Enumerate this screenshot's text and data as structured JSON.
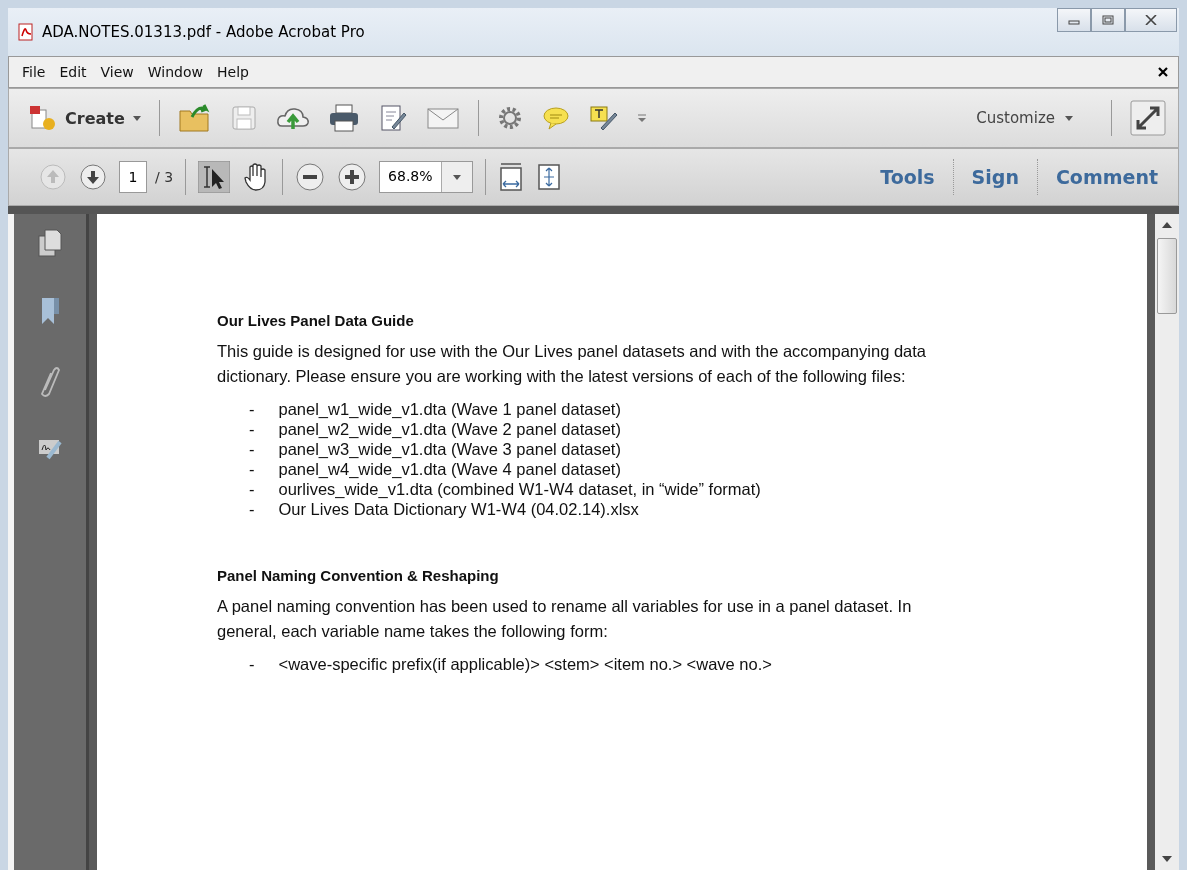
{
  "window": {
    "title": "ADA.NOTES.01313.pdf - Adobe Acrobat Pro"
  },
  "menu": [
    "File",
    "Edit",
    "View",
    "Window",
    "Help"
  ],
  "toolbar": {
    "create_label": "Create",
    "customize_label": "Customize"
  },
  "nav": {
    "page": "1",
    "page_count": "/ 3",
    "zoom": "68.8%"
  },
  "panel_tabs": [
    {
      "label": "Tools",
      "selected": false
    },
    {
      "label": "Sign",
      "selected": false
    },
    {
      "label": "Comment",
      "selected": false
    }
  ],
  "document": {
    "sections": [
      {
        "heading": "Our Lives Panel Data Guide",
        "paragraph": "This guide is designed for use with the Our Lives panel datasets and with the accompanying data dictionary. Please ensure you are working with the latest versions of each of the following files:",
        "bullets": [
          {
            "marker": "-",
            "text": "panel_w1_wide_v1.dta (Wave 1 panel dataset)"
          },
          {
            "marker": "-",
            "text": "panel_w2_wide_v1.dta (Wave 2 panel dataset)"
          },
          {
            "marker": "-",
            "text": "panel_w3_wide_v1.dta (Wave 3 panel dataset)"
          },
          {
            "marker": "-",
            "text": "panel_w4_wide_v1.dta (Wave 4 panel dataset)"
          },
          {
            "marker": "-",
            "text": "ourlives_wide_v1.dta (combined W1-W4 dataset, in “wide” format)"
          },
          {
            "marker": "-",
            "text": "Our Lives Data Dictionary W1-W4 (04.02.14).xlsx"
          }
        ]
      },
      {
        "heading": "Panel Naming Convention & Reshaping",
        "paragraph": "A panel naming convention has been used to rename all variables for use in a panel dataset. In general, each variable name takes the following form:",
        "bullets": [
          {
            "marker": "-",
            "text": "<wave-specific prefix(if applicable)> <stem> <item no.> <wave no.>"
          }
        ]
      }
    ]
  }
}
